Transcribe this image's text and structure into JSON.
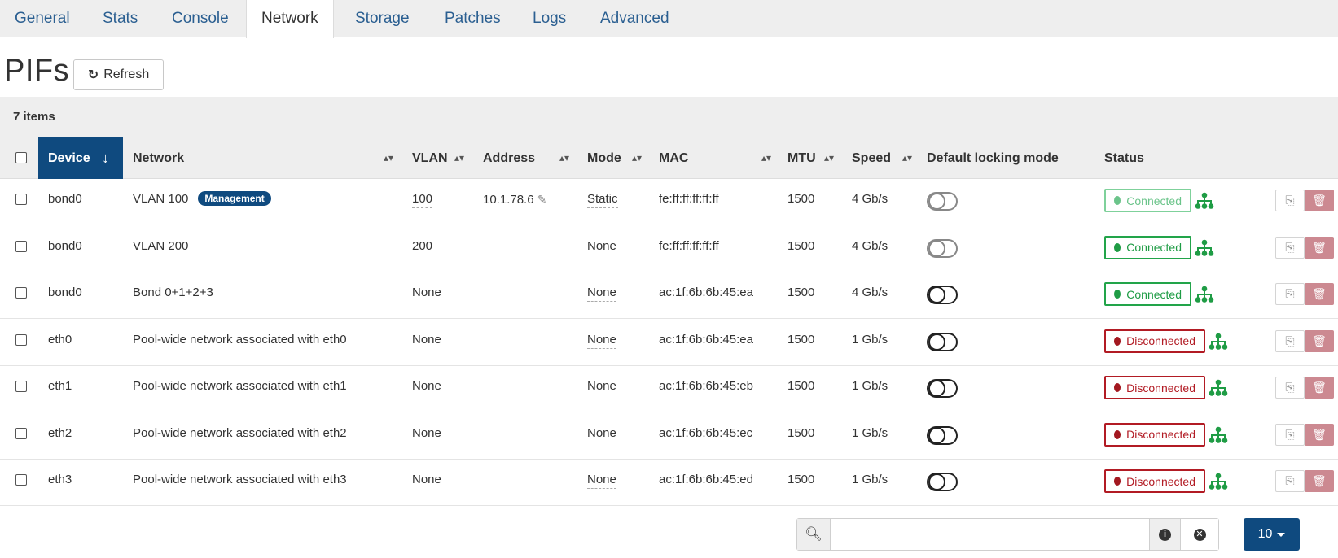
{
  "tabs": [
    {
      "label": "General"
    },
    {
      "label": "Stats"
    },
    {
      "label": "Console"
    },
    {
      "label": "Network",
      "active": true
    },
    {
      "label": "Storage"
    },
    {
      "label": "Patches"
    },
    {
      "label": "Logs"
    },
    {
      "label": "Advanced"
    }
  ],
  "header": {
    "title": "PIFs",
    "refresh_label": "Refresh"
  },
  "table": {
    "items_count": "7 items",
    "columns": {
      "device": "Device",
      "network": "Network",
      "vlan": "VLAN",
      "address": "Address",
      "mode": "Mode",
      "mac": "MAC",
      "mtu": "MTU",
      "speed": "Speed",
      "locking": "Default locking mode",
      "status": "Status"
    },
    "rows": [
      {
        "device": "bond0",
        "network": "VLAN 100",
        "badge": "Management",
        "vlan": "100",
        "address": "10.1.78.6",
        "mode": "Static",
        "mac": "fe:ff:ff:ff:ff:ff",
        "mtu": "1500",
        "speed": "4 Gb/s",
        "status": "Connected"
      },
      {
        "device": "bond0",
        "network": "VLAN 200",
        "badge": "",
        "vlan": "200",
        "address": "",
        "mode": "None",
        "mac": "fe:ff:ff:ff:ff:ff",
        "mtu": "1500",
        "speed": "4 Gb/s",
        "status": "Connected"
      },
      {
        "device": "bond0",
        "network": "Bond 0+1+2+3",
        "badge": "",
        "vlan": "None",
        "address": "",
        "mode": "None",
        "mac": "ac:1f:6b:6b:45:ea",
        "mtu": "1500",
        "speed": "4 Gb/s",
        "status": "Connected"
      },
      {
        "device": "eth0",
        "network": "Pool-wide network associated with eth0",
        "badge": "",
        "vlan": "None",
        "address": "",
        "mode": "None",
        "mac": "ac:1f:6b:6b:45:ea",
        "mtu": "1500",
        "speed": "1 Gb/s",
        "status": "Disconnected"
      },
      {
        "device": "eth1",
        "network": "Pool-wide network associated with eth1",
        "badge": "",
        "vlan": "None",
        "address": "",
        "mode": "None",
        "mac": "ac:1f:6b:6b:45:eb",
        "mtu": "1500",
        "speed": "1 Gb/s",
        "status": "Disconnected"
      },
      {
        "device": "eth2",
        "network": "Pool-wide network associated with eth2",
        "badge": "",
        "vlan": "None",
        "address": "",
        "mode": "None",
        "mac": "ac:1f:6b:6b:45:ec",
        "mtu": "1500",
        "speed": "1 Gb/s",
        "status": "Disconnected"
      },
      {
        "device": "eth3",
        "network": "Pool-wide network associated with eth3",
        "badge": "",
        "vlan": "None",
        "address": "",
        "mode": "None",
        "mac": "ac:1f:6b:6b:45:ed",
        "mtu": "1500",
        "speed": "1 Gb/s",
        "status": "Disconnected"
      }
    ]
  },
  "footer": {
    "filter_value": "",
    "page_size": "10"
  },
  "colors": {
    "accent": "#0f4a7f",
    "connected": "#1f9c45",
    "disconnected": "#b21b24",
    "delete": "#cc8991"
  }
}
